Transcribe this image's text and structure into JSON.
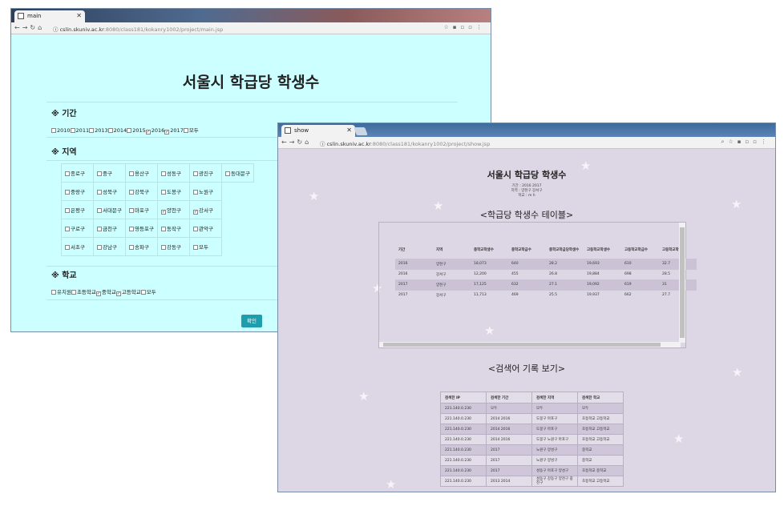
{
  "main_window": {
    "tab_title": "main",
    "url_host": "cslin.skuniv.ac.kr",
    "url_path": ":8080/class181/kokanry1002/project/main.jsp",
    "heading": "서울시 학급당 학생수",
    "period_title": "※ 기간",
    "period_options": [
      {
        "label": "2010",
        "checked": false
      },
      {
        "label": "2011",
        "checked": false
      },
      {
        "label": "2013",
        "checked": false
      },
      {
        "label": "2014",
        "checked": false
      },
      {
        "label": "2015",
        "checked": false
      },
      {
        "label": "2016",
        "checked": true
      },
      {
        "label": "2017",
        "checked": true
      },
      {
        "label": "모두",
        "checked": false
      }
    ],
    "region_title": "※ 지역",
    "region_rows": [
      [
        {
          "label": "종로구",
          "checked": false
        },
        {
          "label": "중구",
          "checked": false
        },
        {
          "label": "용산구",
          "checked": false
        },
        {
          "label": "성동구",
          "checked": false
        },
        {
          "label": "광진구",
          "checked": false
        },
        {
          "label": "동대문구",
          "checked": false
        }
      ],
      [
        {
          "label": "중랑구",
          "checked": false
        },
        {
          "label": "성북구",
          "checked": false
        },
        {
          "label": "강북구",
          "checked": false
        },
        {
          "label": "도봉구",
          "checked": false
        },
        {
          "label": "노원구",
          "checked": false
        }
      ],
      [
        {
          "label": "은평구",
          "checked": false
        },
        {
          "label": "서대문구",
          "checked": false
        },
        {
          "label": "마포구",
          "checked": false
        },
        {
          "label": "양천구",
          "checked": true
        },
        {
          "label": "강서구",
          "checked": true
        }
      ],
      [
        {
          "label": "구로구",
          "checked": false
        },
        {
          "label": "금천구",
          "checked": false
        },
        {
          "label": "영등포구",
          "checked": false
        },
        {
          "label": "동작구",
          "checked": false
        },
        {
          "label": "관악구",
          "checked": false
        }
      ],
      [
        {
          "label": "서초구",
          "checked": false
        },
        {
          "label": "강남구",
          "checked": false
        },
        {
          "label": "송파구",
          "checked": false
        },
        {
          "label": "강동구",
          "checked": false
        },
        {
          "label": "모두",
          "checked": false
        }
      ]
    ],
    "school_title": "※ 학교",
    "school_options": [
      {
        "label": "유치원",
        "checked": false
      },
      {
        "label": "초등학교",
        "checked": false
      },
      {
        "label": "중학교",
        "checked": true
      },
      {
        "label": "고등학교",
        "checked": true
      },
      {
        "label": "모두",
        "checked": false
      }
    ],
    "confirm_label": "확인"
  },
  "show_window": {
    "tab_title": "show",
    "url_host": "cslin.skuniv.ac.kr",
    "url_path": ":8080/class181/kokanry1002/project/show.jsp",
    "heading": "서울시 학급당 학생수",
    "sub_period": "기간 : 2016 2017",
    "sub_region": "지역 : 양천구 강서구",
    "sub_school": "학교 : m h",
    "table_title": "<학급당 학생수 테이블>",
    "table_headers": [
      "기간",
      "지역",
      "중학교학생수",
      "중학교학급수",
      "중학교학급당학생수",
      "고등학교학생수",
      "고등학교학급수",
      "고등학교학"
    ],
    "table_rows": [
      [
        "2016",
        "양천구",
        "18,073",
        "640",
        "28.2",
        "19,693",
        "610",
        "32.7"
      ],
      [
        "2016",
        "강서구",
        "12,200",
        "455",
        "26.8",
        "19,884",
        "698",
        "28.5"
      ],
      [
        "2017",
        "양천구",
        "17,125",
        "632",
        "27.1",
        "19,092",
        "619",
        "31"
      ],
      [
        "2017",
        "강서구",
        "11,713",
        "469",
        "25.5",
        "19,937",
        "662",
        "27.7"
      ]
    ],
    "history_title": "<검색어 기록 보기>",
    "history_headers": [
      "검색한 IP",
      "검색한 기간",
      "검색한 지역",
      "검색한 학교"
    ],
    "history_rows": [
      [
        "221.140.0.230",
        "모두",
        "모두",
        "모두"
      ],
      [
        "221.140.0.230",
        "2014 2016",
        "도봉구 마포구",
        "초등학교 고등학교"
      ],
      [
        "221.140.0.230",
        "2014 2016",
        "도봉구 마포구",
        "초등학교 고등학교"
      ],
      [
        "221.140.0.230",
        "2014 2016",
        "도봉구 노원구 마포구",
        "초등학교 고등학교"
      ],
      [
        "221.140.0.230",
        "2017",
        "노원구 양성구",
        "중학교"
      ],
      [
        "221.140.0.230",
        "2017",
        "노원구 양성구",
        "중학교"
      ],
      [
        "221.140.0.230",
        "2017",
        "성동구 마포구 양성구",
        "초등학교 중학교"
      ],
      [
        "221.140.0.230",
        "2013 2014",
        "성동구 강동구 양천구 광진구",
        "초등학교 고등학교"
      ]
    ]
  }
}
